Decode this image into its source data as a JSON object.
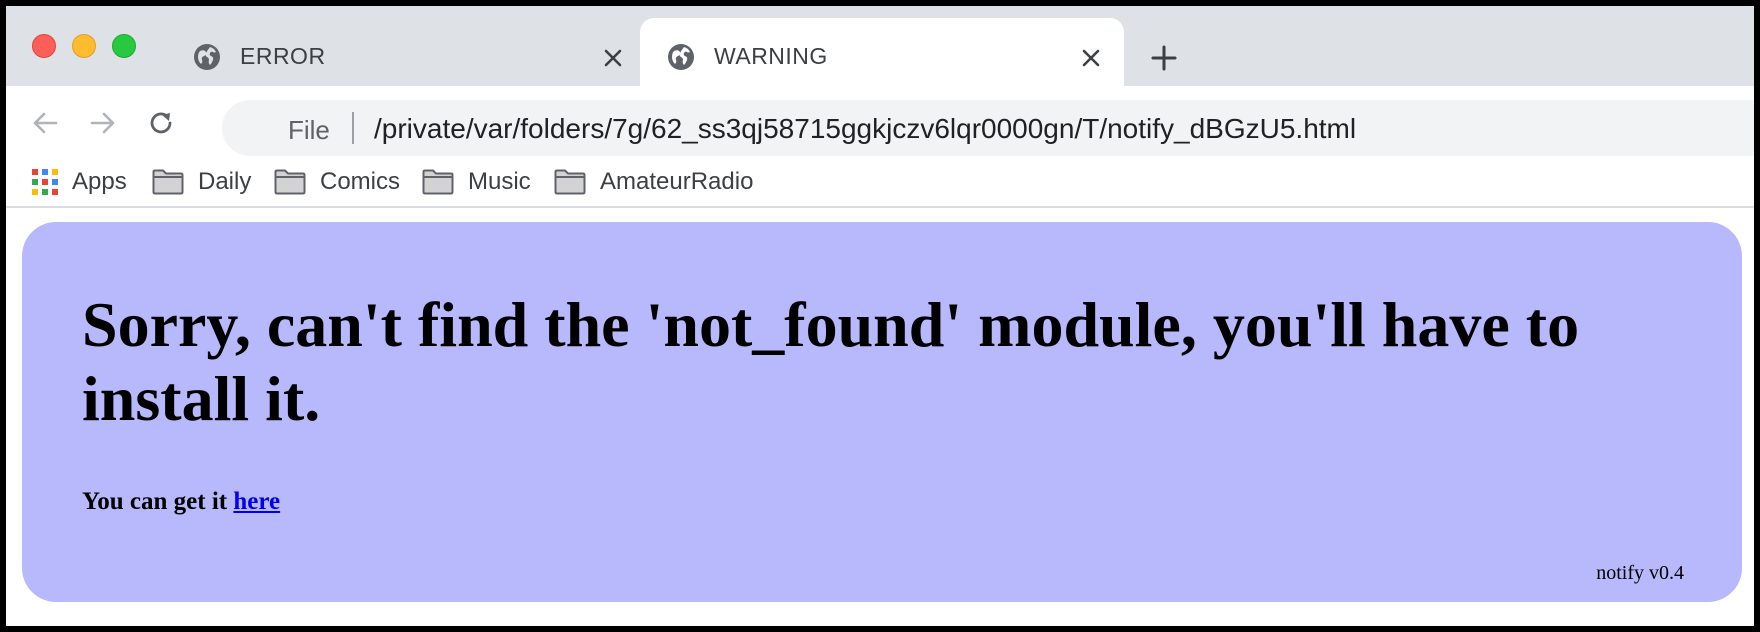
{
  "browser": {
    "tabs": [
      {
        "title": "ERROR",
        "active": false
      },
      {
        "title": "WARNING",
        "active": true
      }
    ],
    "toolbar": {
      "scheme": "File",
      "url": "/private/var/folders/7g/62_ss3qj58715ggkjczv6lqr0000gn/T/notify_dBGzU5.html"
    },
    "bookmarks": [
      {
        "label": "Apps",
        "icon": "apps-grid-icon"
      },
      {
        "label": "Daily",
        "icon": "folder-icon"
      },
      {
        "label": "Comics",
        "icon": "folder-icon"
      },
      {
        "label": "Music",
        "icon": "folder-icon"
      },
      {
        "label": "AmateurRadio",
        "icon": "folder-icon"
      }
    ]
  },
  "page": {
    "headline": "Sorry, can't find the 'not_found' module, you'll have to install it.",
    "sub_text": "You can get it ",
    "link_text": "here",
    "version": "notify v0.4",
    "card_color": "#b8b8fc",
    "link_color": "#0000ee"
  }
}
